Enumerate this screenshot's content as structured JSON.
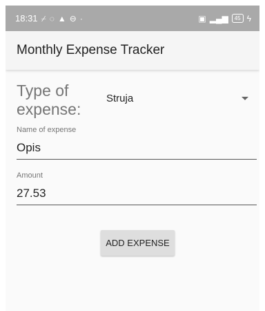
{
  "status_bar": {
    "time": "18:31",
    "left_icons": [
      "wifi-off-icon",
      "whatsapp-icon",
      "alert-icon",
      "timer-icon",
      "dot-icon"
    ],
    "right_icons": [
      "sim-icon",
      "signal-5g-icon"
    ],
    "battery": "45"
  },
  "app_bar": {
    "title": "Monthly Expense Tracker"
  },
  "form": {
    "type_label": "Type of expense:",
    "type_selected": "Struja",
    "name_label": "Name of expense",
    "name_value": "Opis",
    "amount_label": "Amount",
    "amount_value": "27.53",
    "add_button_label": "ADD EXPENSE"
  },
  "colors": {
    "status_bar_bg": "#a9a9a9",
    "app_bar_bg": "#f5f5f5",
    "screen_bg": "#fafafa",
    "button_bg": "#dedede"
  }
}
